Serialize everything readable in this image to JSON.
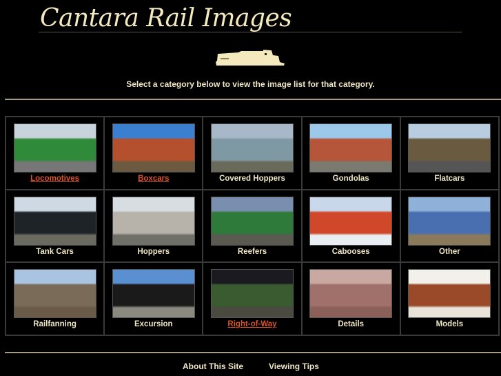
{
  "header": {
    "title": "Cantara Rail Images",
    "intro": "Select a category below to view the image list for that category."
  },
  "categories": [
    {
      "label": "Locomotives",
      "link": true,
      "colors": [
        "#c9d3dc",
        "#2f8a3a",
        "#777"
      ]
    },
    {
      "label": "Boxcars",
      "link": true,
      "colors": [
        "#3a7fd0",
        "#b5502e",
        "#6b5a40"
      ]
    },
    {
      "label": "Covered Hoppers",
      "link": false,
      "colors": [
        "#a8b8c8",
        "#7e98a4",
        "#6a6a5a"
      ]
    },
    {
      "label": "Gondolas",
      "link": false,
      "colors": [
        "#9cc8ea",
        "#b5553a",
        "#7a7a70"
      ]
    },
    {
      "label": "Flatcars",
      "link": false,
      "colors": [
        "#b8cde0",
        "#6a5a40",
        "#555"
      ]
    },
    {
      "label": "Tank Cars",
      "link": false,
      "colors": [
        "#cfd9e3",
        "#1e2328",
        "#6a6a60"
      ]
    },
    {
      "label": "Hoppers",
      "link": false,
      "colors": [
        "#d8dde2",
        "#b7b3aa",
        "#707068"
      ]
    },
    {
      "label": "Reefers",
      "link": false,
      "colors": [
        "#7a8fb0",
        "#2e7a3a",
        "#5a5a50"
      ]
    },
    {
      "label": "Cabooses",
      "link": false,
      "colors": [
        "#c8d8ea",
        "#d0482a",
        "#e8eef2"
      ]
    },
    {
      "label": "Other",
      "link": false,
      "colors": [
        "#8fb0d8",
        "#4a6fb0",
        "#8a7a5a"
      ]
    },
    {
      "label": "Railfanning",
      "link": false,
      "colors": [
        "#a9c4e0",
        "#7a6a58",
        "#6a5a48"
      ]
    },
    {
      "label": "Excursion",
      "link": false,
      "colors": [
        "#5a8fd0",
        "#1a1a1a",
        "#8a8a80"
      ]
    },
    {
      "label": "Right-of-Way",
      "link": true,
      "colors": [
        "#1a1a20",
        "#3a5a30",
        "#4a4a40"
      ]
    },
    {
      "label": "Details",
      "link": false,
      "colors": [
        "#c8a8a0",
        "#a0706a",
        "#8a6058"
      ]
    },
    {
      "label": "Models",
      "link": false,
      "colors": [
        "#f2f0ea",
        "#9a4a28",
        "#e8e4da"
      ]
    }
  ],
  "footer": {
    "about": "About This Site",
    "tips": "Viewing Tips"
  }
}
